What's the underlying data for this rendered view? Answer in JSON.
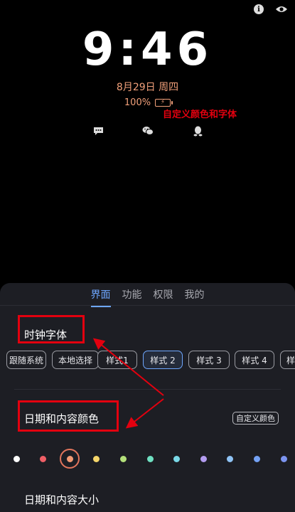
{
  "top_bar": {
    "info_icon": "info-icon",
    "eye_icon": "eye-icon"
  },
  "lock_screen": {
    "time": "9:46",
    "date": "8月29日  周四",
    "battery_percent": "100%",
    "battery_level": 1.0,
    "accent_color": "#f2a07a",
    "notification_icons": [
      "message-icon",
      "wechat-icon",
      "qq-icon"
    ]
  },
  "panel": {
    "tabs": [
      {
        "label": "界面",
        "active": true
      },
      {
        "label": "功能",
        "active": false
      },
      {
        "label": "权限",
        "active": false
      },
      {
        "label": "我的",
        "active": false
      }
    ],
    "clock_font_title": "时钟字体",
    "font_options": [
      {
        "label": "跟随系统",
        "selected": false
      },
      {
        "label": "本地选择",
        "selected": false
      },
      {
        "label": "样式1",
        "selected": false
      },
      {
        "label": "样式 2",
        "selected": true
      },
      {
        "label": "样式 3",
        "selected": false
      },
      {
        "label": "样式 4",
        "selected": false
      }
    ],
    "date_color_title": "日期和内容颜色",
    "custom_button": "自定义颜色",
    "colors": [
      "#ffffff",
      "#ef5f66",
      "#f39a74",
      "#f5d66b",
      "#b4e07b",
      "#6fe0c2",
      "#7ad9e8",
      "#b39cf0",
      "#8fc3f5",
      "#74a2f5",
      "#7c94f0"
    ],
    "selected_color_index": 2,
    "date_size_title": "日期和内容大小"
  },
  "annotation": {
    "text": "自定义颜色和字体",
    "color": "#e3000f"
  }
}
